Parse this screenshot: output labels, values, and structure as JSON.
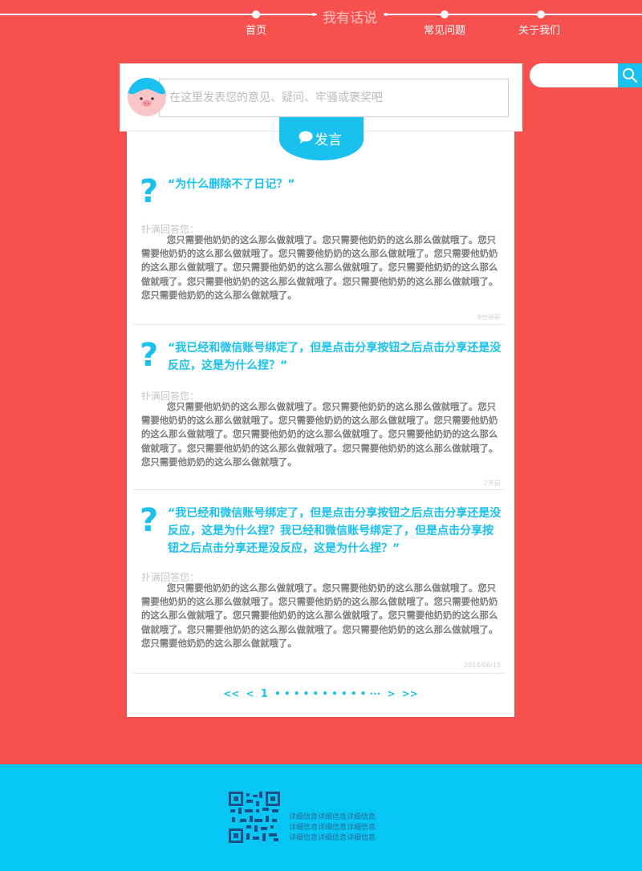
{
  "nav": {
    "title": "我有话说",
    "items": [
      {
        "label": "首页"
      },
      {
        "label": "常见问题"
      },
      {
        "label": "关于我们"
      }
    ]
  },
  "search": {
    "placeholder": "",
    "icon": "search-icon"
  },
  "post": {
    "placeholder": "在这里发表您的意见、疑问、牢骚或褒奖吧",
    "button_label": "发言",
    "button_icon": "chat-bubble-icon"
  },
  "answer_label": "扑满回答您：",
  "questions": [
    {
      "question": "“为什么删除不了日记？”",
      "answer": "您只需要他奶奶的这么那么做就哦了。您只需要他奶奶的这么那么做就哦了。您只需要他奶奶的这么那么做就哦了。您只需要他奶奶的这么那么做就哦了。您只需要他奶奶的这么那么做就哦了。您只需要他奶奶的这么那么做就哦了。您只需要他奶奶的这么那么做就哦了。您只需要他奶奶的这么那么做就哦了。您只需要他奶奶的这么那么做就哦了。您只需要他奶奶的这么那么做就哦了。",
      "meta": "9分钟前"
    },
    {
      "question": "“我已经和微信账号绑定了，但是点击分享按钮之后点击分享还是没反应，这是为什么捏？”",
      "answer": "您只需要他奶奶的这么那么做就哦了。您只需要他奶奶的这么那么做就哦了。您只需要他奶奶的这么那么做就哦了。您只需要他奶奶的这么那么做就哦了。您只需要他奶奶的这么那么做就哦了。您只需要他奶奶的这么那么做就哦了。您只需要他奶奶的这么那么做就哦了。您只需要他奶奶的这么那么做就哦了。您只需要他奶奶的这么那么做就哦了。您只需要他奶奶的这么那么做就哦了。",
      "meta": "2天前"
    },
    {
      "question": "“我已经和微信账号绑定了，但是点击分享按钮之后点击分享还是没反应，这是为什么捏？我已经和微信账号绑定了，但是点击分享按钮之后点击分享还是没反应，这是为什么捏？”",
      "answer": "您只需要他奶奶的这么那么做就哦了。您只需要他奶奶的这么那么做就哦了。您只需要他奶奶的这么那么做就哦了。您只需要他奶奶的这么那么做就哦了。您只需要他奶奶的这么那么做就哦了。您只需要他奶奶的这么那么做就哦了。您只需要他奶奶的这么那么做就哦了。您只需要他奶奶的这么那么做就哦了。您只需要他奶奶的这么那么做就哦了。您只需要他奶奶的这么那么做就哦了。",
      "meta": "2014/06/15"
    }
  ],
  "pagination": {
    "first": "<<",
    "prev": "<",
    "current": "1",
    "dots": "• • • • • • • • • • ···",
    "next": ">",
    "last": ">>"
  },
  "footer": {
    "lines": [
      "详细信息详细信息详细信息",
      "详细信息详细信息详细信息",
      "详细信息详细信息详细信息"
    ]
  },
  "colors": {
    "background": "#f7514f",
    "accent": "#1ac0ee",
    "footer": "#08c6f4"
  }
}
